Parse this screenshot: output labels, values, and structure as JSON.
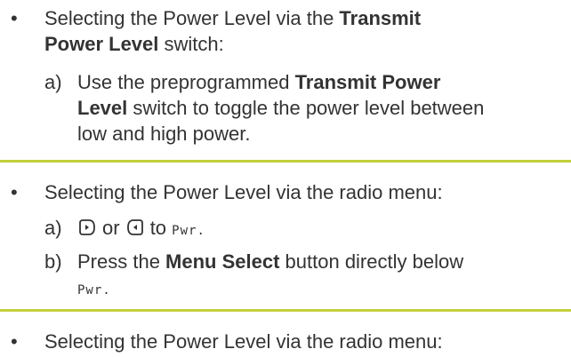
{
  "section1": {
    "bullet": "•",
    "intro_prefix": "Selecting the Power Level via the ",
    "intro_bold1": "Transmit",
    "intro_bold2": "Power Level",
    "intro_suffix": " switch:",
    "step_a": {
      "label": "a)",
      "prefix": "Use the preprogrammed ",
      "bold1": "Transmit Power",
      "bold2": "Level",
      "suffix1": " switch to toggle the power level between",
      "line3": "low and high power."
    }
  },
  "section2": {
    "bullet": "•",
    "intro": "Selecting the Power Level via the radio menu:",
    "step_a": {
      "label": "a)",
      "or": "or",
      "to": "to",
      "lcd": "Pwr."
    },
    "step_b": {
      "label": "b)",
      "prefix": "Press the ",
      "bold": "Menu Select",
      "suffix": " button directly below",
      "lcd": "Pwr."
    }
  },
  "section3": {
    "bullet": "•",
    "intro": "Selecting the Power Level via the radio menu:"
  },
  "icons": {
    "right_key": "right-arrow-key-icon",
    "left_key": "left-arrow-key-icon"
  },
  "colors": {
    "divider": "#c3cf3a",
    "text": "#333333"
  }
}
